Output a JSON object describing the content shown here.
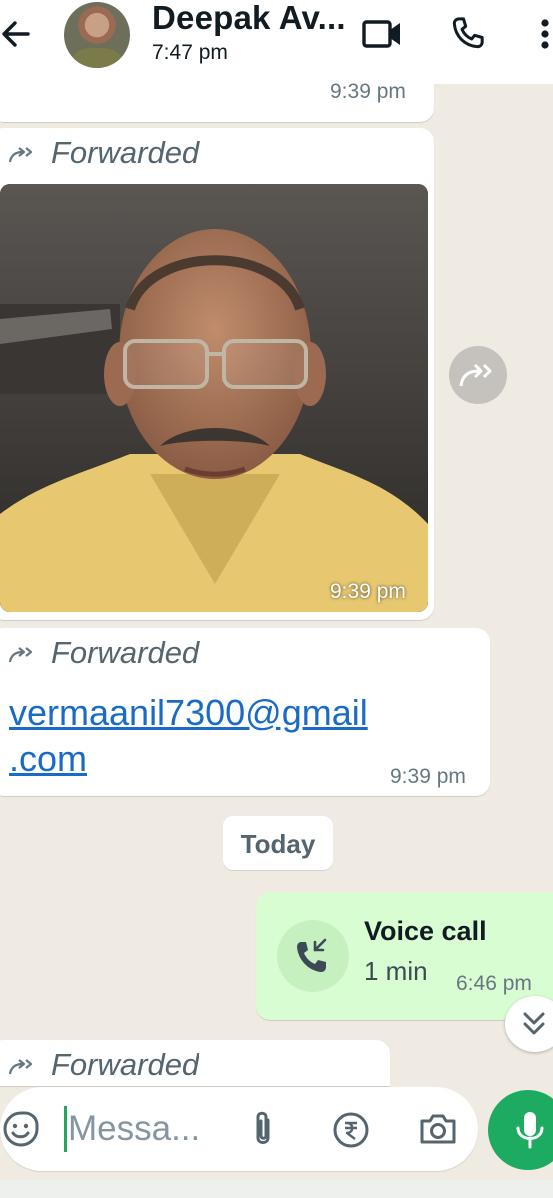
{
  "header": {
    "contact_name": "Deepak Av...",
    "last_seen": "7:47 pm"
  },
  "messages": {
    "top_time": "9:39 pm",
    "photo": {
      "forwarded_label": "Forwarded",
      "time": "9:39 pm"
    },
    "email": {
      "forwarded_label": "Forwarded",
      "text_line1": "vermaanil7300@gmail",
      "text_line2": ".com",
      "time": "9:39 pm"
    },
    "date_chip": "Today",
    "call": {
      "title": "Voice call",
      "duration": "1 min",
      "time": "6:46 pm"
    },
    "last": {
      "forwarded_label": "Forwarded"
    }
  },
  "composer": {
    "placeholder": "Messa..."
  },
  "colors": {
    "chat_background": "#efeae2",
    "outgoing_bubble": "#d9fdd3",
    "accent_green": "#1daa61",
    "link": "#1a6bc6"
  },
  "icons": [
    "back-arrow-icon",
    "video-call-icon",
    "phone-icon",
    "more-vertical-icon",
    "forward-icon",
    "share-icon",
    "call-incoming-icon",
    "chevron-double-down-icon",
    "emoji-icon",
    "attach-icon",
    "rupee-icon",
    "camera-icon",
    "mic-icon"
  ]
}
